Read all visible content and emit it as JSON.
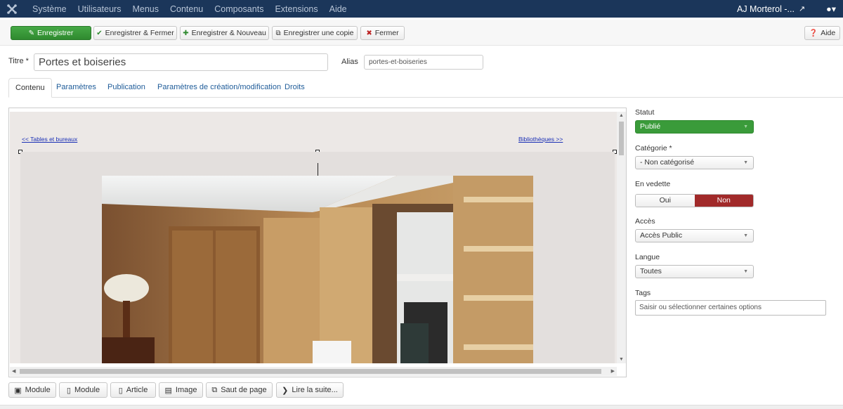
{
  "topnav": {
    "menu": [
      "Système",
      "Utilisateurs",
      "Menus",
      "Contenu",
      "Composants",
      "Extensions",
      "Aide"
    ],
    "user_name": "AJ Morterol -..."
  },
  "toolbar": {
    "save": "Enregistrer",
    "save_close": "Enregistrer & Fermer",
    "save_new": "Enregistrer & Nouveau",
    "save_copy": "Enregistrer une copie",
    "close": "Fermer",
    "help": "Aide"
  },
  "form": {
    "title_label": "Titre *",
    "title_value": "Portes et boiseries",
    "alias_label": "Alias",
    "alias_value": "portes-et-boiseries"
  },
  "tabs": [
    "Contenu",
    "Paramètres",
    "Publication",
    "Paramètres de création/modification",
    "Droits"
  ],
  "editor": {
    "prev_link": "<< Tables et bureaux",
    "next_link": "Bibliothèques >>"
  },
  "editor_buttons": [
    "Module",
    "Module",
    "Article",
    "Image",
    "Saut de page",
    "Lire la suite..."
  ],
  "sidebar": {
    "status_label": "Statut",
    "status_value": "Publié",
    "category_label": "Catégorie *",
    "category_value": "- Non catégorisé",
    "featured_label": "En vedette",
    "featured_yes": "Oui",
    "featured_no": "Non",
    "access_label": "Accès",
    "access_value": "Accès Public",
    "language_label": "Langue",
    "language_value": "Toutes",
    "tags_label": "Tags",
    "tags_placeholder": "Saisir ou sélectionner certaines options"
  },
  "colors": {
    "topbar": "#1b365a",
    "save_green": "#3a9b3a",
    "toggle_red": "#a12a2a",
    "link_blue": "#1f5c99"
  }
}
